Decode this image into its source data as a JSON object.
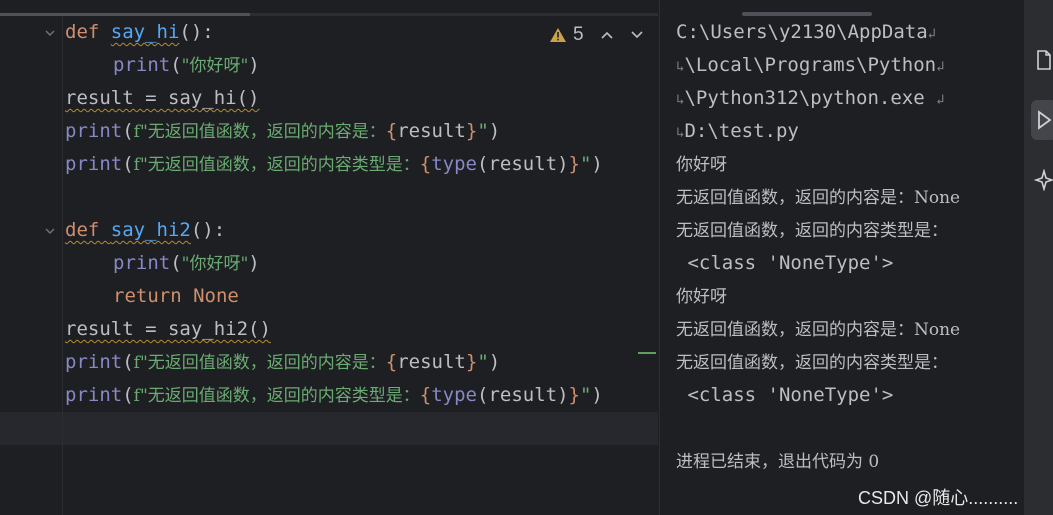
{
  "editor": {
    "warnings": {
      "count": "5",
      "icon": "warning-triangle-icon"
    },
    "lines": [
      {
        "id": "l1",
        "parts": [
          {
            "t": "def ",
            "c": "kw"
          },
          {
            "t": "say_hi",
            "c": "fn"
          },
          {
            "t": "():",
            "c": "br"
          }
        ]
      },
      {
        "id": "l2",
        "indent": true,
        "parts": [
          {
            "t": "print",
            "c": "bi"
          },
          {
            "t": "(",
            "c": "br"
          },
          {
            "t": "\"你好呀\"",
            "c": "str"
          },
          {
            "t": ")",
            "c": "br"
          }
        ]
      },
      {
        "id": "l3",
        "parts": [
          {
            "t": "result = say_hi()",
            "c": "br"
          }
        ]
      },
      {
        "id": "l4",
        "parts": [
          {
            "t": "print",
            "c": "bi"
          },
          {
            "t": "(",
            "c": "br"
          },
          {
            "t": "f\"无返回值函数，返回的内容是：",
            "c": "str"
          },
          {
            "t": "{",
            "c": "kw"
          },
          {
            "t": "result",
            "c": "br"
          },
          {
            "t": "}",
            "c": "kw"
          },
          {
            "t": "\"",
            "c": "str"
          },
          {
            "t": ")",
            "c": "br"
          }
        ]
      },
      {
        "id": "l5",
        "parts": [
          {
            "t": "print",
            "c": "bi"
          },
          {
            "t": "(",
            "c": "br"
          },
          {
            "t": "f\"无返回值函数，返回的内容类型是：",
            "c": "str"
          },
          {
            "t": "{",
            "c": "kw"
          },
          {
            "t": "type",
            "c": "bi"
          },
          {
            "t": "(result)",
            "c": "br"
          },
          {
            "t": "}",
            "c": "kw"
          },
          {
            "t": "\"",
            "c": "str"
          },
          {
            "t": ")",
            "c": "br"
          }
        ]
      },
      {
        "id": "l6",
        "parts": []
      },
      {
        "id": "l7",
        "parts": [
          {
            "t": "def ",
            "c": "kw"
          },
          {
            "t": "say_hi2",
            "c": "fn"
          },
          {
            "t": "():",
            "c": "br"
          }
        ]
      },
      {
        "id": "l8",
        "indent": true,
        "parts": [
          {
            "t": "print",
            "c": "bi"
          },
          {
            "t": "(",
            "c": "br"
          },
          {
            "t": "\"你好呀\"",
            "c": "str"
          },
          {
            "t": ")",
            "c": "br"
          }
        ]
      },
      {
        "id": "l9",
        "indent": true,
        "parts": [
          {
            "t": "return ",
            "c": "kw"
          },
          {
            "t": "None",
            "c": "kw"
          }
        ]
      },
      {
        "id": "l10",
        "parts": [
          {
            "t": "result = say_hi2()",
            "c": "br"
          }
        ]
      },
      {
        "id": "l11",
        "parts": [
          {
            "t": "print",
            "c": "bi"
          },
          {
            "t": "(",
            "c": "br"
          },
          {
            "t": "f\"无返回值函数，返回的内容是：",
            "c": "str"
          },
          {
            "t": "{",
            "c": "kw"
          },
          {
            "t": "result",
            "c": "br"
          },
          {
            "t": "}",
            "c": "kw"
          },
          {
            "t": "\"",
            "c": "str"
          },
          {
            "t": ")",
            "c": "br"
          }
        ]
      },
      {
        "id": "l12",
        "parts": [
          {
            "t": "print",
            "c": "bi"
          },
          {
            "t": "(",
            "c": "br"
          },
          {
            "t": "f\"无返回值函数，返回的内容类型是：",
            "c": "str"
          },
          {
            "t": "{",
            "c": "kw"
          },
          {
            "t": "type",
            "c": "bi"
          },
          {
            "t": "(result)",
            "c": "br"
          },
          {
            "t": "}",
            "c": "kw"
          },
          {
            "t": "\"",
            "c": "str"
          },
          {
            "t": ")",
            "c": "br"
          }
        ]
      },
      {
        "id": "l13",
        "parts": []
      }
    ]
  },
  "console": {
    "lines": [
      {
        "text": "C:\\Users\\y2130\\AppData",
        "wrap_end": true
      },
      {
        "text": "\\Local\\Programs\\Python",
        "wrap_start": true,
        "wrap_end": true
      },
      {
        "text": "\\Python312\\python.exe ",
        "wrap_start": true,
        "wrap_end": true
      },
      {
        "text": "D:\\test.py",
        "wrap_start": true
      },
      {
        "text": "你好呀"
      },
      {
        "text": "无返回值函数，返回的内容是：None"
      },
      {
        "text": "无返回值函数，返回的内容类型是："
      },
      {
        "text": " <class 'NoneType'>"
      },
      {
        "text": "你好呀"
      },
      {
        "text": "无返回值函数，返回的内容是：None"
      },
      {
        "text": "无返回值函数，返回的内容类型是："
      },
      {
        "text": " <class 'NoneType'>"
      },
      {
        "text": ""
      },
      {
        "text": "进程已结束，退出代码为 0"
      }
    ]
  },
  "toolstrip": {
    "buttons": [
      {
        "name": "file-icon"
      },
      {
        "name": "run-icon",
        "active": true
      },
      {
        "name": "ai-sparkle-icon"
      }
    ]
  },
  "watermark": "CSDN @随心..........",
  "colors": {
    "background": "#1e1f22",
    "keyword": "#cf8e6d",
    "function": "#56a8f5",
    "builtin": "#8888c6",
    "string": "#6aab73",
    "text": "#bcbec4"
  }
}
